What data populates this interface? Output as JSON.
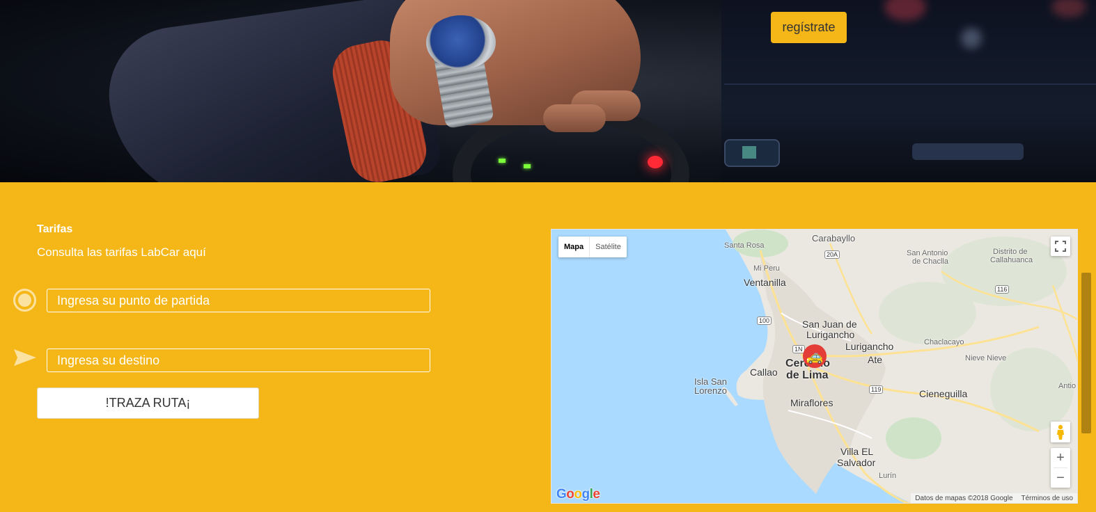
{
  "header": {
    "register_label": "regístrate"
  },
  "tarifas": {
    "title": "Tarifas",
    "subtitle": "Consulta las tarifas LabCar aquí"
  },
  "route_form": {
    "origin_placeholder": "Ingresa su punto de partida",
    "destination_placeholder": "Ingresa su destino",
    "submit_label": "!TRAZA RUTA¡"
  },
  "map": {
    "type_map": "Mapa",
    "type_satellite": "Satélite",
    "attribution_data": "Datos de mapas ©2018 Google",
    "attribution_terms": "Términos de uso",
    "logo_text": "Google",
    "labels": {
      "carabayllo": "Carabayllo",
      "santa_rosa": "Santa Rosa",
      "san_antonio": "San Antonio",
      "de_chacilla": "de Chaclla",
      "distrito_de": "Distrito de",
      "callahuanca": "Callahuanca",
      "mi_peru": "Mi Peru",
      "ventanilla": "Ventanilla",
      "san_juan": "San Juan de",
      "lurigancho_sj": "Lurigancho",
      "lurigancho": "Lurigancho",
      "chaclacayo": "Chaclacayo",
      "ate": "Ate",
      "nieve_nieve": "Nieve Nieve",
      "callao": "Callao",
      "cercado": "Cercado",
      "de_lima": "de Lima",
      "isla": "Isla San",
      "lorenzo": "Lorenzo",
      "miraflores": "Miraflores",
      "cieneguilla": "Cieneguilla",
      "antio": "Antio",
      "villa": "Villa EL",
      "salvador": "Salvador",
      "lurin": "Lurín"
    },
    "shields": {
      "s20a": "20A",
      "s116": "116",
      "s100": "100",
      "s1n": "1N",
      "s119": "119"
    },
    "icons": {
      "fullscreen": "fullscreen-icon",
      "pegman": "pegman-icon",
      "zoom_in": "zoom-in-icon",
      "zoom_out": "zoom-out-icon",
      "car": "car-marker-icon"
    }
  },
  "colors": {
    "accent": "#f5b618",
    "water": "#aadaff",
    "marker": "#e43c36"
  }
}
